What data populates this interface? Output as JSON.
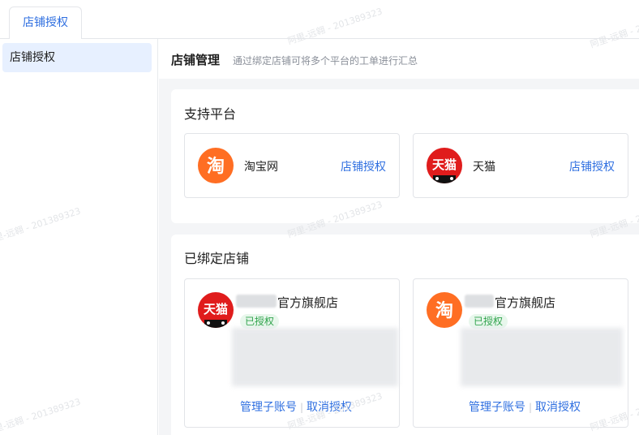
{
  "tabs": [
    {
      "label": "店铺授权"
    }
  ],
  "sidebar": {
    "items": [
      {
        "label": "店铺授权"
      }
    ]
  },
  "header": {
    "title": "店铺管理",
    "description": "通过绑定店铺可将多个平台的工单进行汇总"
  },
  "platforms": {
    "title": "支持平台",
    "items": [
      {
        "name": "淘宝网",
        "logo_text": "淘",
        "action": "店铺授权",
        "icon": "taobao-logo-icon"
      },
      {
        "name": "天猫",
        "logo_text": "天猫",
        "action": "店铺授权",
        "icon": "tmall-logo-icon"
      }
    ]
  },
  "bound": {
    "title": "已绑定店铺",
    "items": [
      {
        "name_suffix": "官方旗舰店",
        "status": "已授权",
        "logo_text": "天猫",
        "icon": "tmall-logo-icon",
        "manage": "管理子账号",
        "cancel": "取消授权"
      },
      {
        "name_suffix": "官方旗舰店",
        "status": "已授权",
        "logo_text": "淘",
        "icon": "taobao-logo-icon",
        "manage": "管理子账号",
        "cancel": "取消授权"
      }
    ]
  },
  "watermark": "阿里-远翱 - 201389323",
  "colors": {
    "accent": "#2f6fe0",
    "taobao": "#ff6e23",
    "tmall": "#e01c1c",
    "authorized": "#2ea24a"
  }
}
